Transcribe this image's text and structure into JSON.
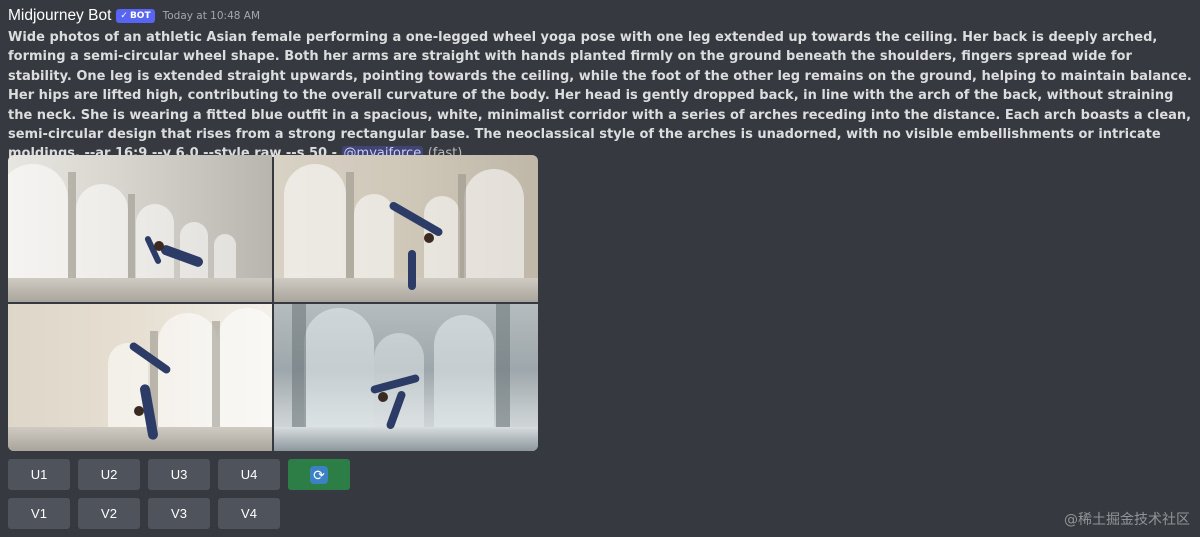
{
  "message": {
    "author": "Midjourney Bot",
    "bot_tag": "BOT",
    "timestamp": "Today at 10:48 AM",
    "prompt_text": "Wide photos of an athletic Asian female performing a one-legged wheel yoga pose with one leg extended up towards the ceiling. Her back is deeply arched, forming a semi-circular wheel shape. Both her arms are straight with hands planted firmly on the ground beneath the shoulders, fingers spread wide for stability. One leg is extended straight upwards, pointing towards the ceiling, while the foot of the other leg remains on the ground, helping to maintain balance. Her hips are lifted high, contributing to the overall curvature of the body. Her head is gently dropped back, in line with the arch of the back, without straining the neck. She is wearing a fitted blue outfit in a spacious, white, minimalist corridor with a series of arches receding into the distance. Each arch boasts a clean, semi-circular design that rises from a strong rectangular base. The neoclassical style of the arches is unadorned, with no visible embellishments or intricate moldings.",
    "params": "--ar 16:9 --v 6.0 --style raw --s 50",
    "separator": "-",
    "mention": "@myaiforce",
    "speed": "(fast)"
  },
  "buttons": {
    "upscale": [
      "U1",
      "U2",
      "U3",
      "U4"
    ],
    "variation": [
      "V1",
      "V2",
      "V3",
      "V4"
    ],
    "reroll_icon": "refresh-icon"
  },
  "watermark": "@稀土掘金技术社区",
  "colors": {
    "background": "#36393f",
    "button": "#4f545c",
    "reroll_button": "#2d7d46",
    "bot_tag": "#5865f2",
    "mention": "#c9cdfb"
  }
}
